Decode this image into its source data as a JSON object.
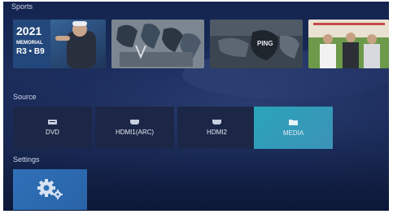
{
  "sections": {
    "sports": {
      "title": "Sports"
    },
    "source": {
      "title": "Source"
    },
    "settings": {
      "title": "Settings"
    }
  },
  "thumbnails": {
    "t1": {
      "year": "2021",
      "caption1": "MEMORIAL",
      "caption2": "R3 • B9"
    },
    "t2": {},
    "t3": {
      "brand": "PING"
    },
    "t4": {}
  },
  "source_tiles": [
    {
      "label": "DVD",
      "icon": "dvd-icon"
    },
    {
      "label": "HDMI1(ARC)",
      "icon": "hdmi-icon"
    },
    {
      "label": "HDMI2",
      "icon": "hdmi-icon"
    },
    {
      "label": "MEDIA",
      "icon": "folder-icon",
      "selected": true
    }
  ],
  "settings_tile": {
    "icon": "gear-icon"
  },
  "colors": {
    "selected_tile": "#2aa4b9",
    "settings_tile": "#2f70b7",
    "background": "#172750"
  }
}
